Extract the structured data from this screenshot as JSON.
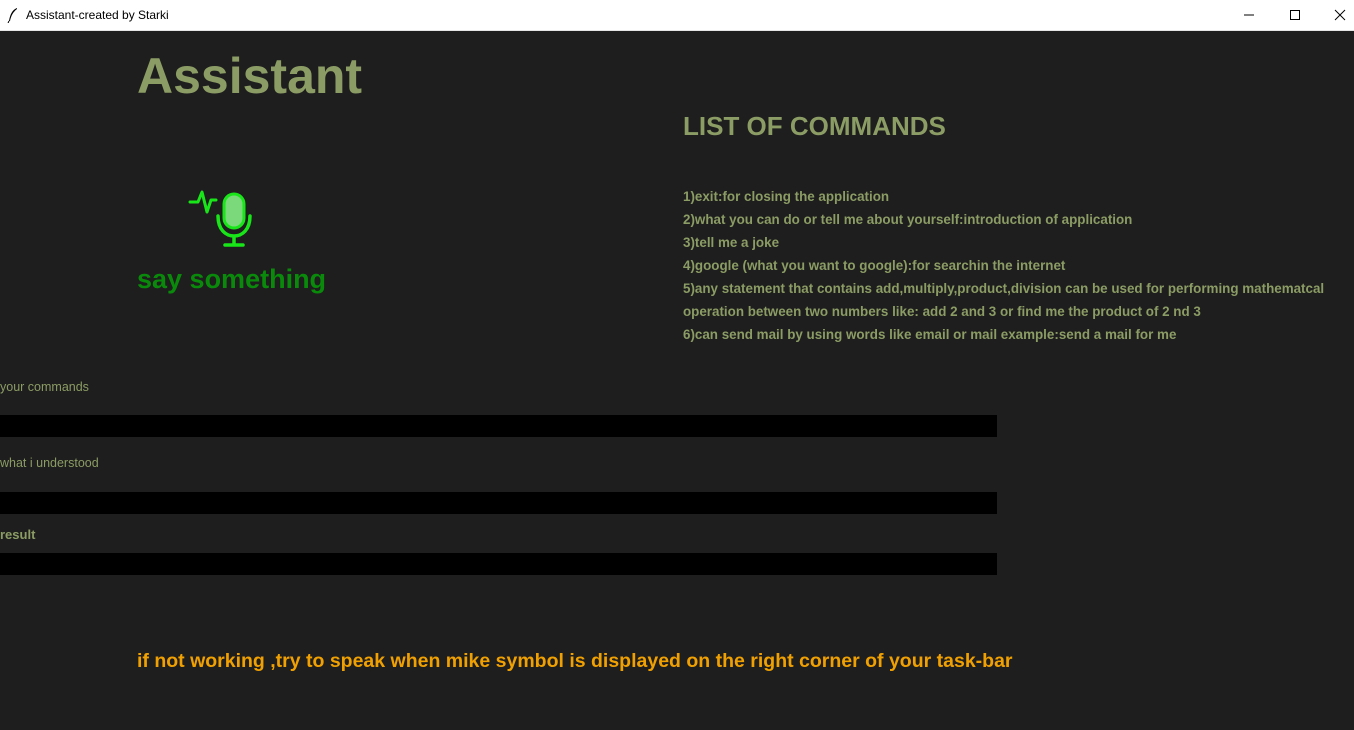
{
  "window": {
    "title": "Assistant-created by Starki",
    "icon": "feather-icon",
    "controls": [
      "minimize-icon",
      "maximize-icon",
      "close-icon"
    ]
  },
  "app": {
    "title": "Assistant",
    "status_icon": "microphone-icon",
    "status_text": "say something"
  },
  "commands": {
    "heading": "LIST OF COMMANDS",
    "items": [
      "1)exit:for closing the application",
      "2)what you can do or tell me about yourself:introduction of application",
      "3)tell me a joke",
      "4)google (what you want to google):for searchin the internet",
      "5)any statement that contains add,multiply,product,division can be used for performing mathematcal operation between two numbers like: add 2 and 3 or find me the product of 2 nd 3",
      "6)can send mail by using words like email or mail example:send a mail for me"
    ]
  },
  "fields": {
    "commands_label": "your commands",
    "commands_value": "",
    "understood_label": "what i understood",
    "understood_value": "",
    "result_label": "result",
    "result_value": ""
  },
  "hint": "if not working ,try to speak when mike symbol is displayed on the right corner of your task-bar",
  "colors": {
    "background": "#1e1e1e",
    "accent": "#8b9c64",
    "status_green": "#0a8a0a",
    "mic_green": "#19e619",
    "warning_orange": "#f0a000",
    "field_bg": "#000000"
  }
}
